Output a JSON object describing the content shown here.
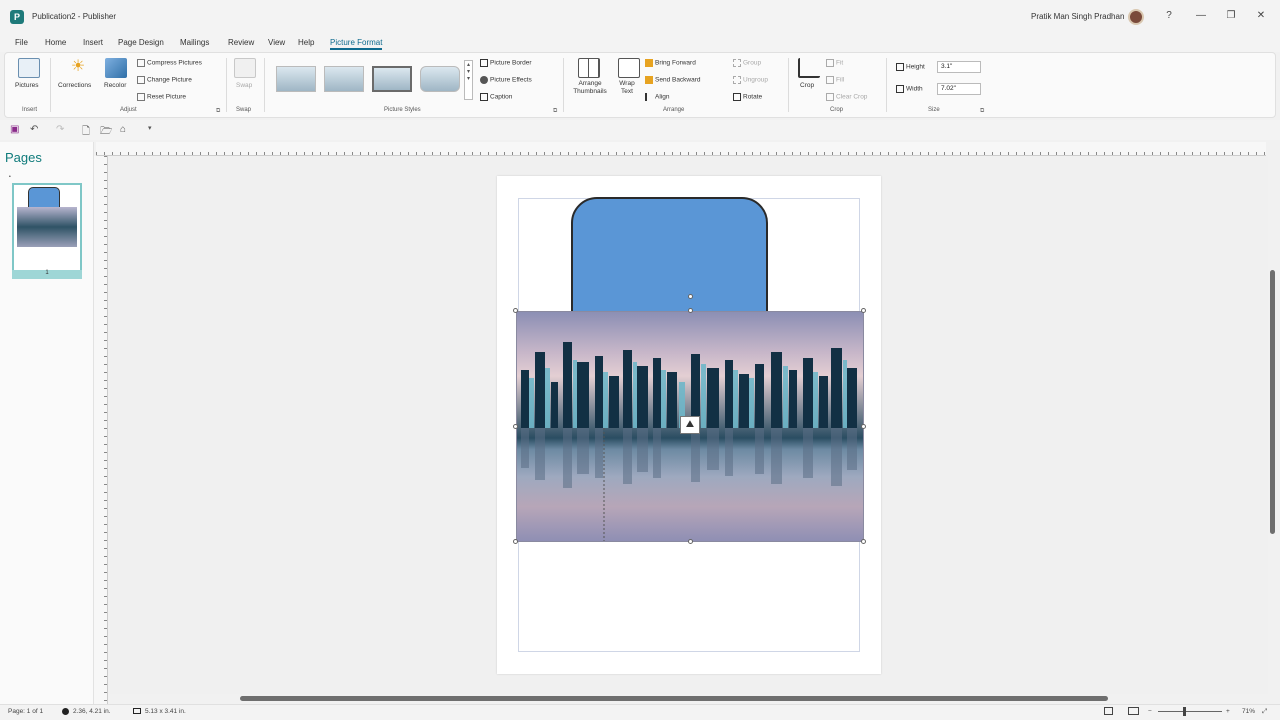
{
  "titlebar": {
    "app_initial": "P",
    "doc_title": "Publication2 - Publisher",
    "user_name": "Pratik Man Singh Pradhan",
    "help": "?",
    "minimize": "—",
    "restore": "❐",
    "close": "✕"
  },
  "tabs": [
    "File",
    "Home",
    "Insert",
    "Page Design",
    "Mailings",
    "Review",
    "View",
    "Help",
    "Picture Format"
  ],
  "ribbon": {
    "insert": {
      "pictures": "Pictures",
      "group": "Insert"
    },
    "adjust": {
      "corrections": "Corrections",
      "recolor": "Recolor",
      "compress": "Compress Pictures",
      "change": "Change Picture",
      "reset": "Reset Picture",
      "group": "Adjust"
    },
    "swap": {
      "swap": "Swap",
      "group": "Swap"
    },
    "picture_styles": {
      "group": "Picture Styles",
      "border": "Picture Border",
      "effects": "Picture Effects",
      "caption": "Caption"
    },
    "arrange": {
      "arrange_thumbnails": "Arrange Thumbnails",
      "wrap_text": "Wrap Text",
      "bring_forward": "Bring Forward",
      "send_backward": "Send Backward",
      "align": "Align",
      "group_btn": "Group",
      "ungroup": "Ungroup",
      "rotate": "Rotate",
      "group": "Arrange"
    },
    "crop": {
      "crop": "Crop",
      "fit": "Fit",
      "fill": "Fill",
      "clear_crop": "Clear Crop",
      "group": "Crop"
    },
    "size": {
      "height_label": "Height",
      "height_value": "3.1\"",
      "width_label": "Width",
      "width_value": "7.02\"",
      "group": "Size"
    }
  },
  "pages_pane": {
    "title": "Pages",
    "thumb_number": "1"
  },
  "status": {
    "page": "Page: 1 of 1",
    "position": "2.36, 4.21 in.",
    "size": "5.13 x 3.41 in.",
    "zoom": "71%"
  }
}
